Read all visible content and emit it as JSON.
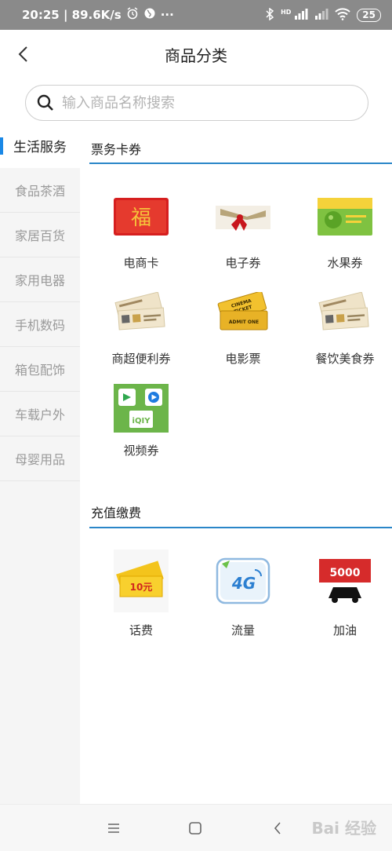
{
  "status_bar": {
    "time_speed": "20:25 | 89.6K/s",
    "dots": "···",
    "network": "HD",
    "battery": "25"
  },
  "header": {
    "title": "商品分类"
  },
  "search": {
    "placeholder": "输入商品名称搜索"
  },
  "sidebar": {
    "items": [
      {
        "label": "生活服务",
        "active": true
      },
      {
        "label": "食品茶酒",
        "active": false
      },
      {
        "label": "家居百货",
        "active": false
      },
      {
        "label": "家用电器",
        "active": false
      },
      {
        "label": "手机数码",
        "active": false
      },
      {
        "label": "箱包配饰",
        "active": false
      },
      {
        "label": "车载户外",
        "active": false
      },
      {
        "label": "母婴用品",
        "active": false
      }
    ]
  },
  "sections": [
    {
      "title": "票务卡券",
      "items": [
        {
          "label": "电商卡",
          "icon": "red-fu-card-icon"
        },
        {
          "label": "电子券",
          "icon": "gift-ribbon-coupon-icon"
        },
        {
          "label": "水果券",
          "icon": "green-apple-card-icon"
        },
        {
          "label": "商超便利券",
          "icon": "coupon-tickets-icon"
        },
        {
          "label": "电影票",
          "icon": "cinema-ticket-icon"
        },
        {
          "label": "餐饮美食券",
          "icon": "coupon-tickets-icon"
        },
        {
          "label": "视频券",
          "icon": "video-apps-icon"
        }
      ]
    },
    {
      "title": "充值缴费",
      "items": [
        {
          "label": "话费",
          "icon": "phone-credit-ticket-icon"
        },
        {
          "label": "流量",
          "icon": "4g-data-icon"
        },
        {
          "label": "加油",
          "icon": "fuel-card-icon"
        }
      ]
    }
  ],
  "thumb_text": {
    "cinema": "CINEMA",
    "ticket": "TICKET",
    "admit": "ADMIT ONE",
    "fu": "福",
    "ten_yuan": "10元",
    "four_g": "4G",
    "fuel_amount": "5000",
    "iqiyi": "iQIY"
  },
  "watermark": "Bai 经验",
  "colors": {
    "accent": "#1a88e6",
    "divider": "#2a86c8",
    "status_bg": "#8a8a8a"
  }
}
